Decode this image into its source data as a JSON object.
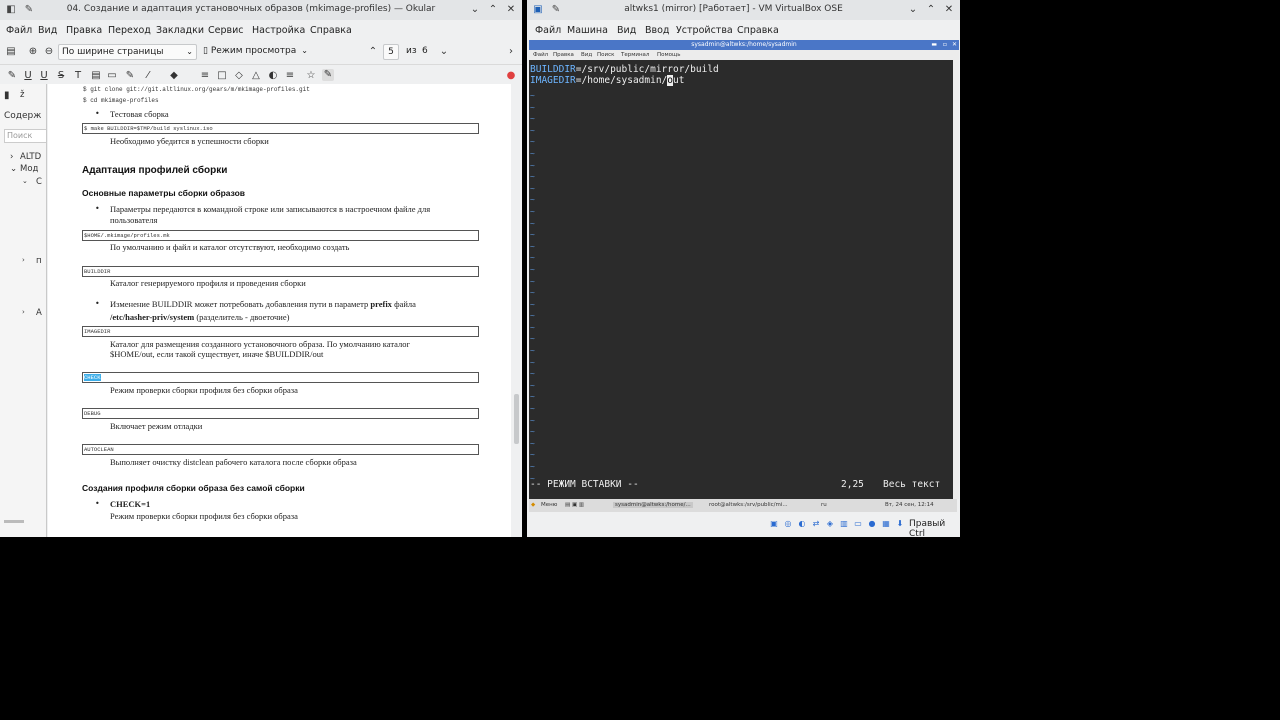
{
  "okular": {
    "title": "04. Создание и адаптация установочных образов (mkimage-profiles) — Okular",
    "menu": [
      "Файл",
      "Вид",
      "Правка",
      "Переход",
      "Закладки",
      "Сервис",
      "Настройка",
      "Справка"
    ],
    "zoom_mode": "По ширине страницы",
    "view_mode": "Режим просмотра",
    "page_current": "5",
    "page_of": "из",
    "page_total": "6",
    "sidebar": {
      "tab_label": "Содерж",
      "search_placeholder": "Поиск",
      "items": [
        "ALTD",
        "Мод",
        "С",
        "п",
        "А"
      ]
    },
    "doc": {
      "code_clone": "$ git clone git://git.altlinux.org/gears/m/mkimage-profiles.git",
      "code_cd": "$ cd mkimage-profiles",
      "bullet_test": "Тестовая сборка",
      "code_make": "$ make BUILDDIR=$TMP/build syslinux.iso",
      "text_check_success": "Необходимо убедится в успешности сборки",
      "h2_adapt": "Адаптация профилей сборки",
      "h3_params": "Основные параметры сборки образов",
      "bullet_params_1": "Параметры передаются в командной строке или записываются в настроечном файле для",
      "bullet_params_2": "пользователя",
      "code_profiles": "$HOME/.mkimage/profiles.mk",
      "text_default_absent": "По умолчанию и файл и каталог отсутствуют, необходимо создать",
      "code_builddir": "BUILDDIR",
      "text_builddir": "Каталог генерируемого профиля и проведения сборки",
      "bullet_change_1a": "Изменение BUILDDIR может потребовать добавления пути в параметр ",
      "bullet_change_1b": "prefix",
      "bullet_change_1c": " файла",
      "bullet_change_2a": "/etc/hasher-priv/system",
      "bullet_change_2b": " (разделитель - двоеточие)",
      "code_imagedir": "IMAGEDIR",
      "text_imagedir_1": "Каталог для размещения созданного установочного образа. По умолчанию каталог",
      "text_imagedir_2": "$HOME/out, если такой существует, иначе $BUILDDIR/out",
      "code_check": "CHECK",
      "text_check": "Режим проверки сборки профиля без сборки образа",
      "code_debug": "DEBUG",
      "text_debug": "Включает режим отладки",
      "code_autoclean": "AUTOCLEAN",
      "text_autoclean": "Выполняет очистку distclean рабочего каталога после сборки образа",
      "h3_create": "Создания профиля сборки образа без самой сборки",
      "bullet_check": "CHECK=1",
      "text_check2": "Режим проверки сборки профиля без сборки образа"
    }
  },
  "vbox": {
    "title": "altwks1 (mirror) [Работает] - VM VirtualBox OSE",
    "menu": [
      "Файл",
      "Машина",
      "Вид",
      "Ввод",
      "Устройства",
      "Справка"
    ],
    "guest_title": "sysadmin@altwks:/home/sysadmin",
    "guest_menu": [
      "Файл",
      "Правка",
      "Вид",
      "Поиск",
      "Терминал",
      "Помощь"
    ],
    "term": {
      "line1_key": "BUILDDIR",
      "line1_val": "=/srv/public/mirror/build",
      "line2_key": "IMAGEDIR",
      "line2_val_pre": "=/home/sysadmin/",
      "line2_cursor": "o",
      "line2_val_post": "ut",
      "mode": "-- РЕЖИМ ВСТАВКИ --",
      "position": "2,25",
      "scope": "Весь текст"
    },
    "taskbar": [
      "Меню",
      "sysadmin@altwks:/home/...",
      "root@altwks:/srv/public/mi...",
      "ru",
      "Вт, 24 сен, 12:14"
    ],
    "host_key": "Правый Ctrl"
  }
}
